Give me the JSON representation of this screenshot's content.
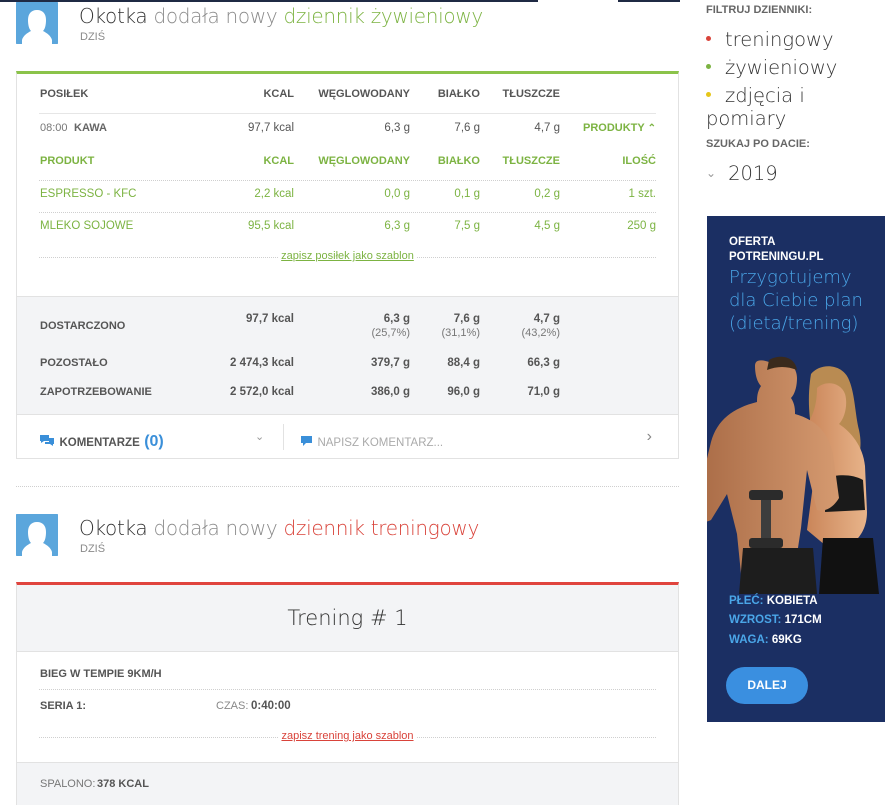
{
  "post1": {
    "user": "Okotka",
    "verb": "dodała nowy",
    "entry_type": "dziennik żywieniowy",
    "date": "DZIŚ"
  },
  "diet": {
    "headers": [
      "POSIŁEK",
      "KCAL",
      "WĘGLOWODANY",
      "BIAŁKO",
      "TŁUSZCZE"
    ],
    "meal": {
      "time": "08:00",
      "name": "KAWA",
      "kcal": "97,7 kcal",
      "carbs": "6,3 g",
      "protein": "7,6 g",
      "fat": "4,7 g",
      "toggle": "PRODUKTY"
    },
    "product_headers": [
      "PRODUKT",
      "KCAL",
      "WĘGLOWODANY",
      "BIAŁKO",
      "TŁUSZCZE",
      "ILOŚĆ"
    ],
    "products": [
      {
        "name": "ESPRESSO - KFC",
        "kcal": "2,2 kcal",
        "carbs": "0,0 g",
        "protein": "0,1 g",
        "fat": "0,2 g",
        "qty": "1 szt."
      },
      {
        "name": "MLEKO SOJOWE",
        "kcal": "95,5 kcal",
        "carbs": "6,3 g",
        "protein": "7,5 g",
        "fat": "4,5 g",
        "qty": "250 g"
      }
    ],
    "save_template": "zapisz posiłek jako szablon",
    "summary": {
      "delivered": {
        "label": "DOSTARCZONO",
        "kcal": "97,7 kcal",
        "carbs": "6,3 g",
        "carbs_pct": "(25,7%)",
        "protein": "7,6 g",
        "protein_pct": "(31,1%)",
        "fat": "4,7 g",
        "fat_pct": "(43,2%)"
      },
      "remaining": {
        "label": "POZOSTAŁO",
        "kcal": "2 474,3 kcal",
        "carbs": "379,7 g",
        "protein": "88,4 g",
        "fat": "66,3 g"
      },
      "required": {
        "label": "ZAPOTRZEBOWANIE",
        "kcal": "2 572,0 kcal",
        "carbs": "386,0 g",
        "protein": "96,0 g",
        "fat": "71,0 g"
      }
    },
    "comments_label": "KOMENTARZE",
    "comments_count": "(0)",
    "comment_placeholder": "NAPISZ KOMENTARZ..."
  },
  "post2": {
    "user": "Okotka",
    "verb": "dodała nowy",
    "entry_type": "dziennik treningowy",
    "date": "DZIŚ"
  },
  "training": {
    "title": "Trening # 1",
    "exercise": "BIEG W TEMPIE 9KM/H",
    "series_label": "SERIA 1:",
    "time_label": "CZAS:",
    "time_value": "0:40:00",
    "save_template": "zapisz trening jako szablon",
    "burned_label": "SPALONO:",
    "burned_value": "378 KCAL"
  },
  "sidebar": {
    "filter_title": "FILTRUJ DZIENNIKI:",
    "filters": [
      {
        "label": "treningowy",
        "color": "#d9433a"
      },
      {
        "label": "żywieniowy",
        "color": "#7cb342"
      },
      {
        "label": "zdjęcia i pomiary",
        "color": "#e6c619"
      }
    ],
    "date_title": "SZUKAJ PO DACIE:",
    "year": "2019"
  },
  "ad": {
    "line1": "OFERTA",
    "line2": "POTRENINGU.PL",
    "headline1": "Przygotujemy",
    "headline2": "dla Ciebie plan",
    "headline3": "(dieta/trening)",
    "sex_k": "PŁEĆ:",
    "sex_v": "KOBIETA",
    "height_k": "WZROST:",
    "height_v": "171CM",
    "weight_k": "WAGA:",
    "weight_v": "69KG",
    "button": "DALEJ"
  },
  "colors": {
    "green": "#7cb342",
    "red": "#d9433a",
    "blue": "#3a8fd9",
    "ad_bg": "#1b2f63"
  }
}
